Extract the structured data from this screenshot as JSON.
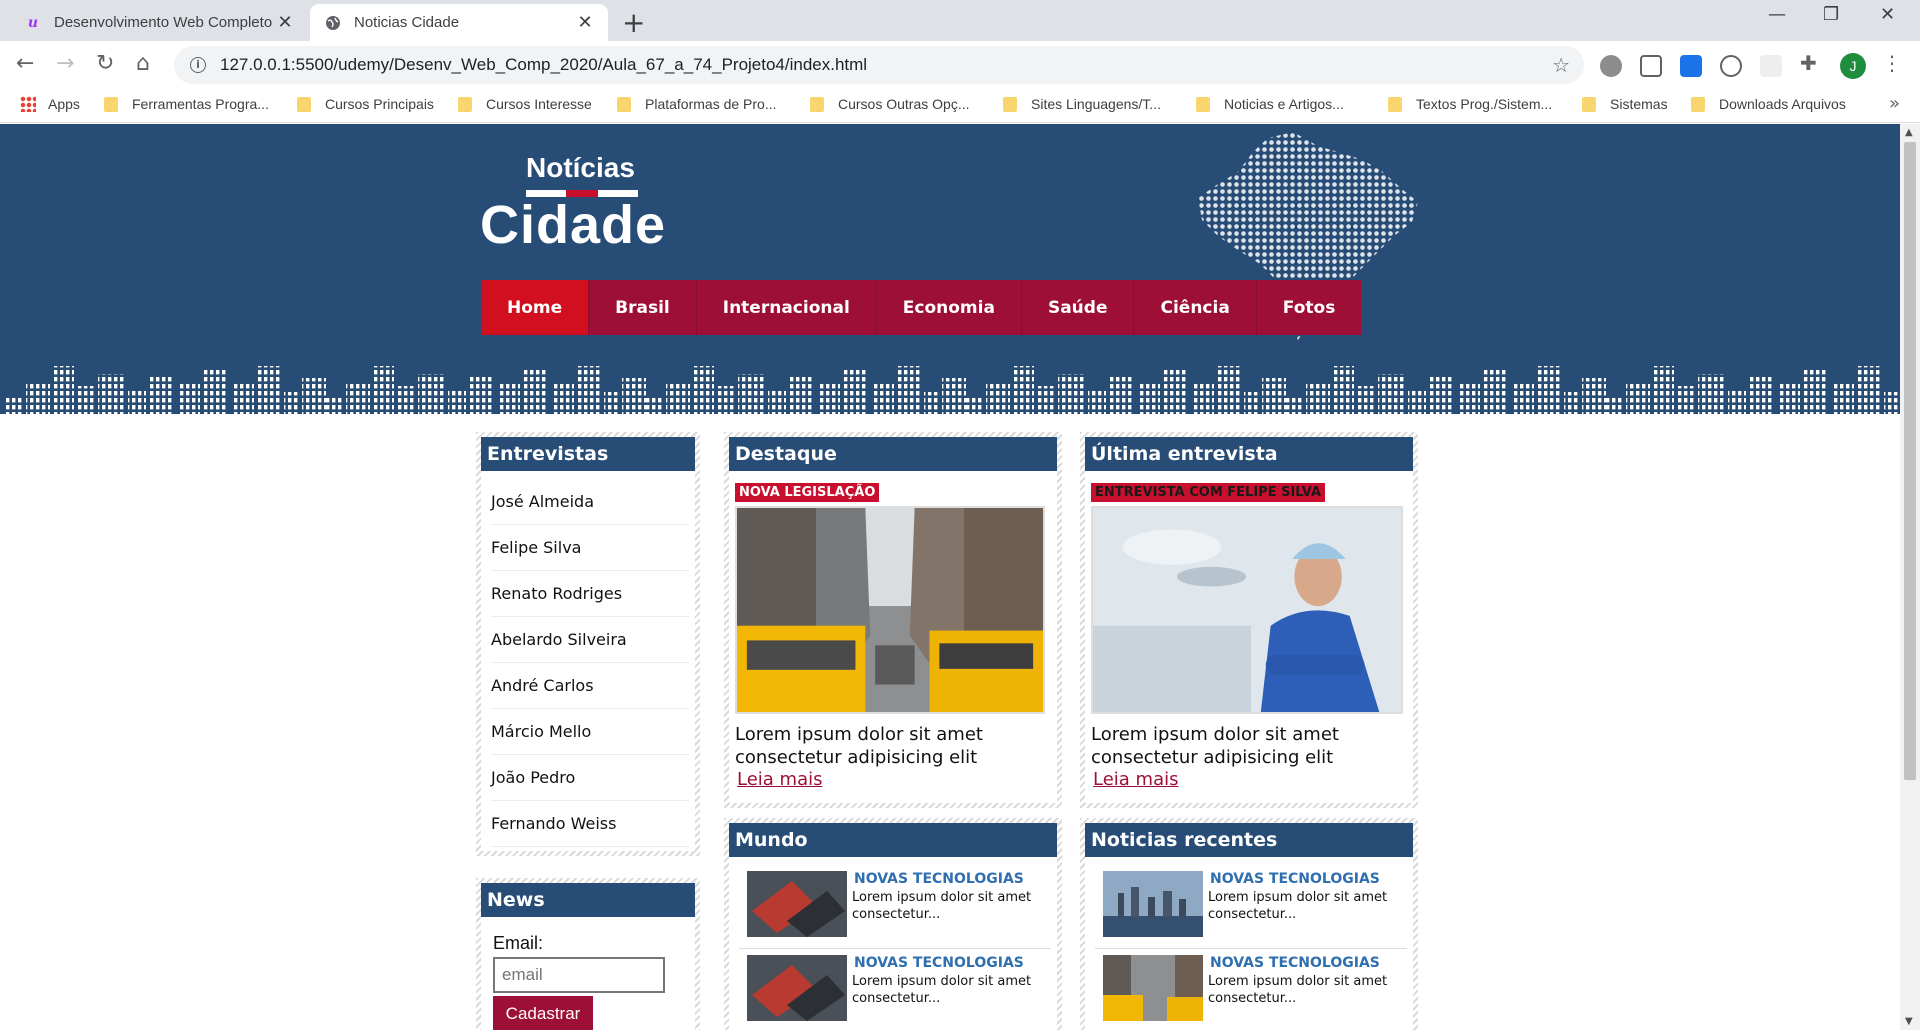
{
  "browser": {
    "tabs": [
      {
        "title": "Desenvolvimento Web Completo",
        "favicon": "udemy-icon"
      },
      {
        "title": "Noticias Cidade",
        "favicon": "globe-icon"
      }
    ],
    "new_tab": "+",
    "controls": {
      "minimize": "—",
      "maximize": "❐",
      "close": "✕"
    },
    "url": "127.0.0.1:5500/udemy/Desenv_Web_Comp_2020/Aula_67_a_74_Projeto4/index.html",
    "profile_initial": "J",
    "bookmarks": [
      "Apps",
      "Ferramentas Progra...",
      "Cursos Principais",
      "Cursos Interesse",
      "Plataformas de Pro...",
      "Cursos Outras Opç...",
      "Sites Linguagens/T...",
      "Noticias e Artigos...",
      "Textos Prog./Sistem...",
      "Sistemas",
      "Downloads Arquivos"
    ],
    "bookmarks_more": "»"
  },
  "site": {
    "logo_top": "Notícias",
    "logo_bottom": "Cidade",
    "nav": [
      "Home",
      "Brasil",
      "Internacional",
      "Economia",
      "Saúde",
      "Ciência",
      "Fotos"
    ],
    "colors": {
      "header": "#274c76",
      "accent": "#c8102e",
      "nav": "#9e0f37",
      "nav_active": "#d10f1f"
    }
  },
  "entrevistas": {
    "title": "Entrevistas",
    "names": [
      "José Almeida",
      "Felipe Silva",
      "Renato Rodriges",
      "Abelardo Silveira",
      "André Carlos",
      "Márcio Mello",
      "João Pedro",
      "Fernando Weiss"
    ]
  },
  "news_form": {
    "title": "News",
    "email_label": "Email:",
    "email_placeholder": "email",
    "submit": "Cadastrar"
  },
  "destaque": {
    "title": "Destaque",
    "badge": "NOVA LEGISLAÇÃO",
    "text": "Lorem ipsum dolor sit amet consectetur adipisicing elit",
    "more": "Leia mais"
  },
  "ultima": {
    "title": "Última entrevista",
    "badge": "ENTREVISTA COM FELIPE SILVA",
    "text": "Lorem ipsum dolor sit amet consectetur adipisicing elit",
    "more": "Leia mais"
  },
  "mundo": {
    "title": "Mundo",
    "items": [
      {
        "kicker": "NOVAS TECNOLOGIAS",
        "text": "Lorem ipsum dolor sit amet consectetur..."
      },
      {
        "kicker": "NOVAS TECNOLOGIAS",
        "text": "Lorem ipsum dolor sit amet consectetur..."
      }
    ]
  },
  "recentes": {
    "title": "Noticias recentes",
    "items": [
      {
        "kicker": "NOVAS TECNOLOGIAS",
        "text": "Lorem ipsum dolor sit amet consectetur..."
      },
      {
        "kicker": "NOVAS TECNOLOGIAS",
        "text": "Lorem ipsum dolor sit amet consectetur..."
      }
    ]
  }
}
